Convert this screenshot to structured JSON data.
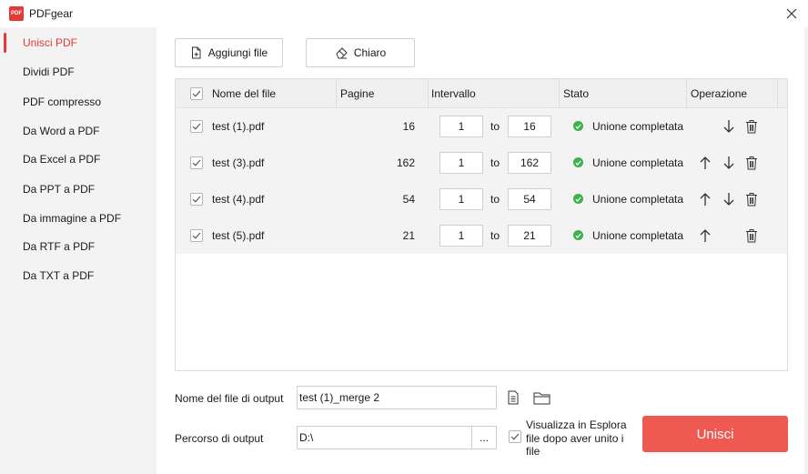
{
  "app": {
    "title": "PDFgear",
    "logo_text": "PDF"
  },
  "sidebar": {
    "items": [
      {
        "label": "Unisci PDF",
        "active": true
      },
      {
        "label": "Dividi PDF"
      },
      {
        "label": "PDF compresso"
      },
      {
        "label": "Da Word a PDF"
      },
      {
        "label": "Da Excel a PDF"
      },
      {
        "label": "Da PPT a PDF"
      },
      {
        "label": "Da immagine a PDF"
      },
      {
        "label": "Da RTF a PDF"
      },
      {
        "label": "Da TXT a PDF"
      }
    ]
  },
  "toolbar": {
    "add_label": "Aggiungi file",
    "clear_label": "Chiaro"
  },
  "table": {
    "headers": {
      "name": "Nome del file",
      "pages": "Pagine",
      "range": "Intervallo",
      "status": "Stato",
      "operation": "Operazione"
    },
    "to_label": "to",
    "rows": [
      {
        "name": "test (1).pdf",
        "pages": "16",
        "from": "1",
        "to": "16",
        "status": "Unione completata"
      },
      {
        "name": "test (3).pdf",
        "pages": "162",
        "from": "1",
        "to": "162",
        "status": "Unione completata"
      },
      {
        "name": "test (4).pdf",
        "pages": "54",
        "from": "1",
        "to": "54",
        "status": "Unione completata"
      },
      {
        "name": "test (5).pdf",
        "pages": "21",
        "from": "1",
        "to": "21",
        "status": "Unione completata"
      }
    ]
  },
  "output": {
    "name_label": "Nome del file di output",
    "name_value": "test (1)_merge 2",
    "path_label": "Percorso di output",
    "path_value": "D:\\",
    "browse_label": "...",
    "show_label": "Visualizza in Esplora file dopo aver unito i file",
    "merge_label": "Unisci"
  },
  "colors": {
    "accent": "#e53935",
    "merge_button": "#ee5a52",
    "success": "#3cb34a"
  }
}
